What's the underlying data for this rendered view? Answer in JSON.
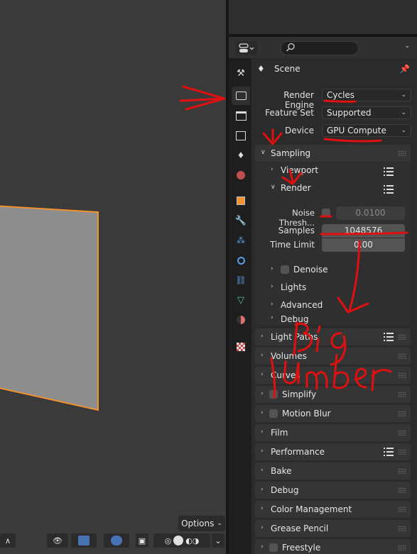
{
  "viewport": {
    "options_label": "Options"
  },
  "properties": {
    "scene_label": "Scene",
    "render_engine": {
      "label": "Render Engine",
      "value": "Cycles"
    },
    "feature_set": {
      "label": "Feature Set",
      "value": "Supported"
    },
    "device": {
      "label": "Device",
      "value": "GPU Compute"
    },
    "sampling": {
      "title": "Sampling",
      "viewport_label": "Viewport",
      "render_label": "Render",
      "noise_threshold": {
        "label": "Noise Thresh...",
        "value": "0.0100"
      },
      "samples": {
        "label": "Samples",
        "value": "1048576"
      },
      "time_limit": {
        "label": "Time Limit",
        "value": "0.00"
      },
      "denoise_label": "Denoise",
      "lights_label": "Lights",
      "advanced_label": "Advanced",
      "debug_label": "Debug"
    },
    "panels": {
      "light_paths": "Light Paths",
      "volumes": "Volumes",
      "curves": "Curves",
      "simplify": "Simplify",
      "motion_blur": "Motion Blur",
      "film": "Film",
      "performance": "Performance",
      "bake": "Bake",
      "debug": "Debug",
      "color_management": "Color Management",
      "grease_pencil": "Grease Pencil",
      "freestyle": "Freestyle"
    }
  },
  "annotations": {
    "handwriting": "Big number",
    "color": "#e01010"
  },
  "colors": {
    "accent_orange": "#f0922f",
    "field_bg": "#545454",
    "panel_bg": "#353535"
  }
}
